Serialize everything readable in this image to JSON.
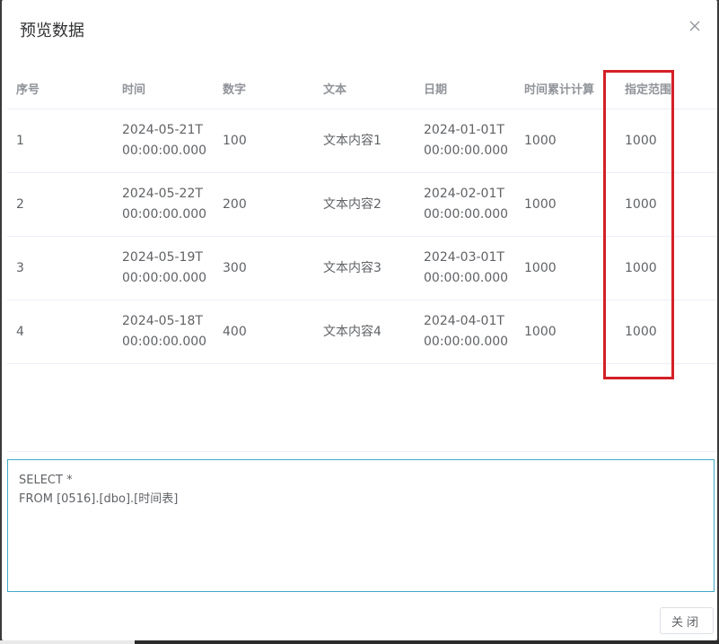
{
  "dialog": {
    "title": "预览数据",
    "close_icon": "close-icon"
  },
  "table": {
    "headers": [
      "序号",
      "时间",
      "数字",
      "文本",
      "日期",
      "时间累计计算",
      "指定范围"
    ],
    "rows": [
      [
        "1",
        "2024-05-21T00:00:00.000",
        "100",
        "文本内容1",
        "2024-01-01T00:00:00.000",
        "1000",
        "1000"
      ],
      [
        "2",
        "2024-05-22T00:00:00.000",
        "200",
        "文本内容2",
        "2024-02-01T00:00:00.000",
        "1000",
        "1000"
      ],
      [
        "3",
        "2024-05-19T00:00:00.000",
        "300",
        "文本内容3",
        "2024-03-01T00:00:00.000",
        "1000",
        "1000"
      ],
      [
        "4",
        "2024-05-18T00:00:00.000",
        "400",
        "文本内容4",
        "2024-04-01T00:00:00.000",
        "1000",
        "1000"
      ]
    ]
  },
  "highlight": {
    "color": "#d42027",
    "target_column": "指定范围"
  },
  "sql": {
    "line1": "SELECT *",
    "line2": "FROM [0516].[dbo].[时间表]",
    "border_color": "#40a9c8"
  },
  "footer": {
    "close_button_label": "关闭"
  }
}
